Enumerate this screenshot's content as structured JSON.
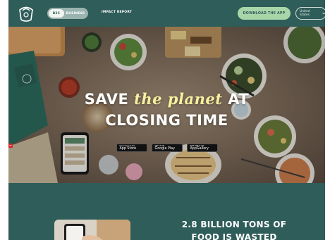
{
  "colors": {
    "brand_teal": "#2f5d59",
    "cta_green": "#a9d6a9",
    "accent_yellow": "#f6f0a0"
  },
  "header": {
    "logo_icon": "toogoodtogo-bag-logo",
    "segment": {
      "active": "B2C",
      "inactive": "BUSINESS"
    },
    "impact_link": "IMPACT REPORT",
    "cta_label": "DOWNLOAD THE APP",
    "country_label": "United States",
    "country_icon": "chevron-down-icon"
  },
  "hero": {
    "headline_part1": "SAVE ",
    "headline_accent": "the planet",
    "headline_part2": " AT",
    "headline_line2": "CLOSING TIME",
    "stores": [
      {
        "top": "Download on the",
        "label": "App Store",
        "icon": "apple-icon"
      },
      {
        "top": "GET IT ON",
        "label": "Google Play",
        "icon": "play-icon"
      },
      {
        "top": "EXPLORE IT ON",
        "label": "AppGallery",
        "icon": "huawei-icon"
      }
    ]
  },
  "bottom": {
    "stat_line1": "2.8 BILLION TONS OF",
    "stat_line2": "FOOD IS WASTED EVERY"
  }
}
